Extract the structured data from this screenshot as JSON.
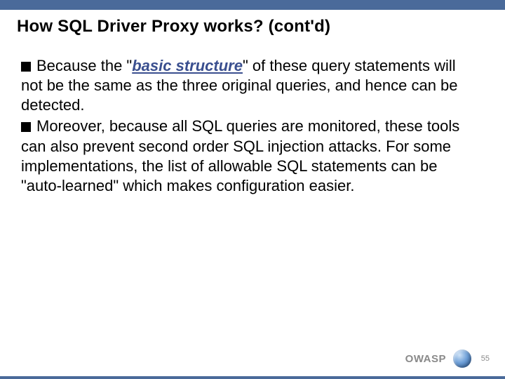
{
  "slide": {
    "title": "How SQL Driver Proxy works? (cont'd)",
    "bullets": [
      {
        "prefix": "Because the \"",
        "emph": "basic structure",
        "suffix": "\" of these query statements will not be the same as the three original queries, and hence can be detected."
      },
      {
        "text": "Moreover, because all SQL queries are monitored, these tools can also prevent second order SQL injection attacks. For some implementations, the list of allowable SQL statements can be \"auto-learned\" which makes configuration easier."
      }
    ]
  },
  "footer": {
    "brand": "OWASP",
    "page_number": "55"
  },
  "colors": {
    "bar": "#4a6a9a",
    "emph_text": "#3a4f8f"
  }
}
